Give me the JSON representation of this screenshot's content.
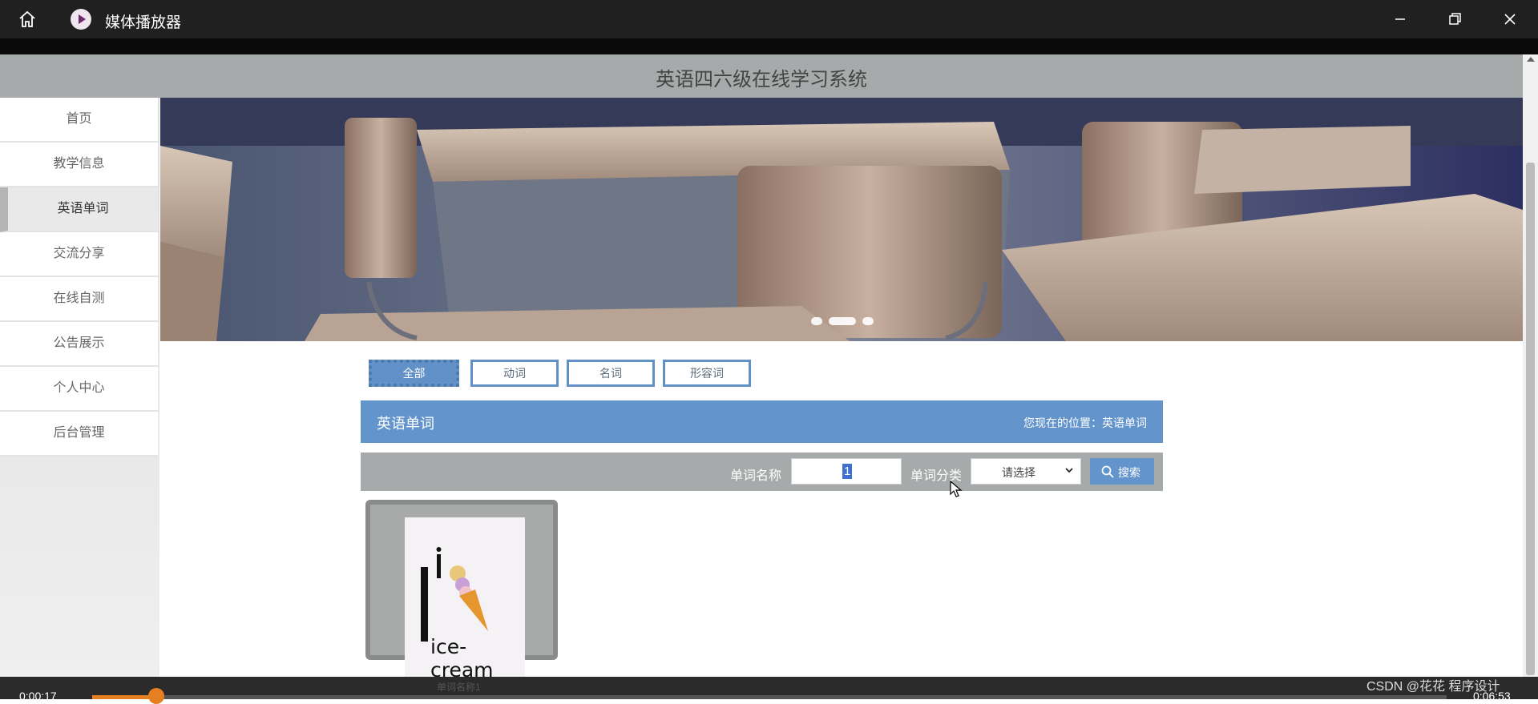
{
  "window": {
    "title": "媒体播放器",
    "icons": [
      "home-icon",
      "media-player-icon",
      "minimize-icon",
      "restore-icon",
      "close-icon"
    ]
  },
  "site": {
    "title": "英语四六级在线学习系统"
  },
  "sidebar": {
    "items": [
      {
        "label": "首页",
        "active": false
      },
      {
        "label": "教学信息",
        "active": false
      },
      {
        "label": "英语单词",
        "active": true
      },
      {
        "label": "交流分享",
        "active": false
      },
      {
        "label": "在线自测",
        "active": false
      },
      {
        "label": "公告展示",
        "active": false
      },
      {
        "label": "个人中心",
        "active": false
      },
      {
        "label": "后台管理",
        "active": false
      }
    ]
  },
  "banner": {
    "slides": 3,
    "current": 2
  },
  "categories": [
    {
      "label": "全部",
      "active": true
    },
    {
      "label": "动词",
      "active": false
    },
    {
      "label": "名词",
      "active": false
    },
    {
      "label": "形容词",
      "active": false
    }
  ],
  "section": {
    "title": "英语单词",
    "location": "您现在的位置：英语单词"
  },
  "search": {
    "name_label": "单词名称",
    "name_value": "1",
    "category_label": "单词分类",
    "category_value": "请选择",
    "button_label": "搜索"
  },
  "card": {
    "image_text": "ice-cream",
    "image_letter": "i",
    "label": "单词名称1"
  },
  "player": {
    "current_time": "0:00:17",
    "total_time": "0:06:53",
    "progress": 0.041
  },
  "watermark": "CSDN @花花 程序设计",
  "colors": {
    "accent": "#6394cc",
    "header": "#a7aaaa",
    "titlebar": "#202020",
    "progress": "#e67e22"
  }
}
